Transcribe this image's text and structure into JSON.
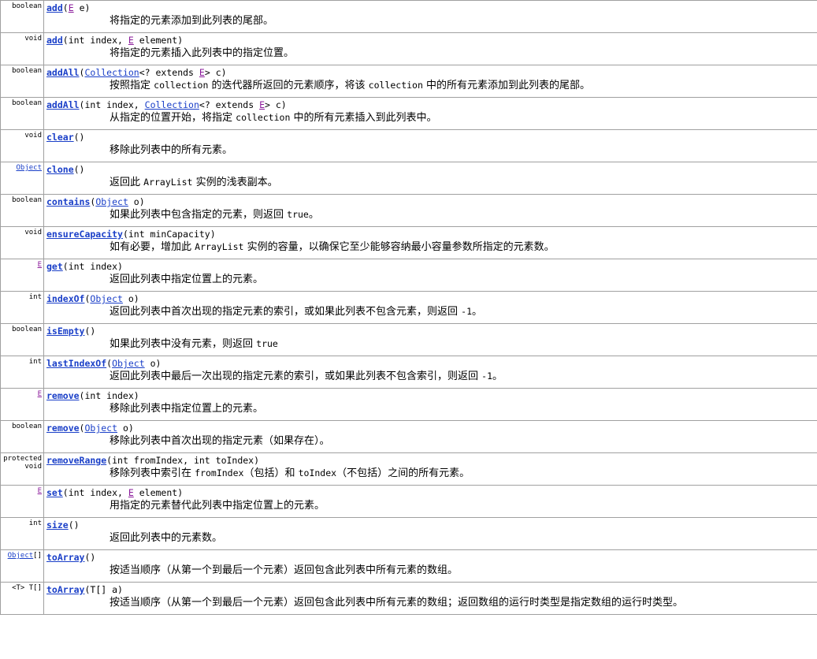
{
  "methods": [
    {
      "type": [
        {
          "text": "boolean",
          "link": false
        }
      ],
      "sig": [
        {
          "t": "name",
          "v": "add"
        },
        {
          "t": "plain",
          "v": "("
        },
        {
          "t": "generic",
          "v": "E"
        },
        {
          "t": "plain",
          "v": " e)"
        }
      ],
      "desc": [
        {
          "t": "text",
          "v": "将指定的元素添加到此列表的尾部。"
        }
      ]
    },
    {
      "type": [
        {
          "text": "void",
          "link": false
        }
      ],
      "sig": [
        {
          "t": "name",
          "v": "add"
        },
        {
          "t": "plain",
          "v": "(int index, "
        },
        {
          "t": "generic",
          "v": "E"
        },
        {
          "t": "plain",
          "v": " element)"
        }
      ],
      "desc": [
        {
          "t": "text",
          "v": "将指定的元素插入此列表中的指定位置。"
        }
      ]
    },
    {
      "type": [
        {
          "text": "boolean",
          "link": false
        }
      ],
      "sig": [
        {
          "t": "name",
          "v": "addAll"
        },
        {
          "t": "plain",
          "v": "("
        },
        {
          "t": "link",
          "v": "Collection"
        },
        {
          "t": "plain",
          "v": "<? extends "
        },
        {
          "t": "generic",
          "v": "E"
        },
        {
          "t": "plain",
          "v": "> c)"
        }
      ],
      "desc": [
        {
          "t": "text",
          "v": "按照指定 "
        },
        {
          "t": "code",
          "v": "collection"
        },
        {
          "t": "text",
          "v": " 的迭代器所返回的元素顺序，将该 "
        },
        {
          "t": "code",
          "v": "collection"
        },
        {
          "t": "text",
          "v": " 中的所有元素添加到此列表的尾部。"
        }
      ]
    },
    {
      "type": [
        {
          "text": "boolean",
          "link": false
        }
      ],
      "sig": [
        {
          "t": "name",
          "v": "addAll"
        },
        {
          "t": "plain",
          "v": "(int index, "
        },
        {
          "t": "link",
          "v": "Collection"
        },
        {
          "t": "plain",
          "v": "<? extends "
        },
        {
          "t": "generic",
          "v": "E"
        },
        {
          "t": "plain",
          "v": "> c)"
        }
      ],
      "desc": [
        {
          "t": "text",
          "v": "从指定的位置开始，将指定 "
        },
        {
          "t": "code",
          "v": "collection"
        },
        {
          "t": "text",
          "v": " 中的所有元素插入到此列表中。"
        }
      ]
    },
    {
      "type": [
        {
          "text": "void",
          "link": false
        }
      ],
      "sig": [
        {
          "t": "name",
          "v": "clear"
        },
        {
          "t": "plain",
          "v": "()"
        }
      ],
      "desc": [
        {
          "t": "text",
          "v": "移除此列表中的所有元素。"
        }
      ]
    },
    {
      "type": [
        {
          "text": "Object",
          "link": true
        }
      ],
      "sig": [
        {
          "t": "name",
          "v": "clone"
        },
        {
          "t": "plain",
          "v": "()"
        }
      ],
      "desc": [
        {
          "t": "text",
          "v": "返回此 "
        },
        {
          "t": "code",
          "v": "ArrayList"
        },
        {
          "t": "text",
          "v": " 实例的浅表副本。"
        }
      ]
    },
    {
      "type": [
        {
          "text": "boolean",
          "link": false
        }
      ],
      "sig": [
        {
          "t": "name",
          "v": "contains"
        },
        {
          "t": "plain",
          "v": "("
        },
        {
          "t": "link",
          "v": "Object"
        },
        {
          "t": "plain",
          "v": " o)"
        }
      ],
      "desc": [
        {
          "t": "text",
          "v": "如果此列表中包含指定的元素，则返回 "
        },
        {
          "t": "code",
          "v": "true"
        },
        {
          "t": "text",
          "v": "。"
        }
      ]
    },
    {
      "type": [
        {
          "text": "void",
          "link": false
        }
      ],
      "sig": [
        {
          "t": "name",
          "v": "ensureCapacity"
        },
        {
          "t": "plain",
          "v": "(int minCapacity)"
        }
      ],
      "desc": [
        {
          "t": "text",
          "v": "如有必要，增加此 "
        },
        {
          "t": "code",
          "v": "ArrayList"
        },
        {
          "t": "text",
          "v": " 实例的容量，以确保它至少能够容纳最小容量参数所指定的元素数。"
        }
      ]
    },
    {
      "type": [
        {
          "text": "E",
          "link": true,
          "generic": true
        }
      ],
      "sig": [
        {
          "t": "name",
          "v": "get"
        },
        {
          "t": "plain",
          "v": "(int index)"
        }
      ],
      "desc": [
        {
          "t": "text",
          "v": "返回此列表中指定位置上的元素。"
        }
      ]
    },
    {
      "type": [
        {
          "text": "int",
          "link": false
        }
      ],
      "sig": [
        {
          "t": "name",
          "v": "indexOf"
        },
        {
          "t": "plain",
          "v": "("
        },
        {
          "t": "link",
          "v": "Object"
        },
        {
          "t": "plain",
          "v": " o)"
        }
      ],
      "desc": [
        {
          "t": "text",
          "v": "返回此列表中首次出现的指定元素的索引，或如果此列表不包含元素，则返回 "
        },
        {
          "t": "code",
          "v": "-1"
        },
        {
          "t": "text",
          "v": "。"
        }
      ]
    },
    {
      "type": [
        {
          "text": "boolean",
          "link": false
        }
      ],
      "sig": [
        {
          "t": "name",
          "v": "isEmpty"
        },
        {
          "t": "plain",
          "v": "()"
        }
      ],
      "desc": [
        {
          "t": "text",
          "v": "如果此列表中没有元素，则返回 "
        },
        {
          "t": "code",
          "v": "true"
        }
      ]
    },
    {
      "type": [
        {
          "text": "int",
          "link": false
        }
      ],
      "sig": [
        {
          "t": "name",
          "v": "lastIndexOf"
        },
        {
          "t": "plain",
          "v": "("
        },
        {
          "t": "link",
          "v": "Object"
        },
        {
          "t": "plain",
          "v": " o)"
        }
      ],
      "desc": [
        {
          "t": "text",
          "v": "返回此列表中最后一次出现的指定元素的索引，或如果此列表不包含索引，则返回 "
        },
        {
          "t": "code",
          "v": "-1"
        },
        {
          "t": "text",
          "v": "。"
        }
      ]
    },
    {
      "type": [
        {
          "text": "E",
          "link": true,
          "generic": true
        }
      ],
      "sig": [
        {
          "t": "name",
          "v": "remove"
        },
        {
          "t": "plain",
          "v": "(int index)"
        }
      ],
      "desc": [
        {
          "t": "text",
          "v": "移除此列表中指定位置上的元素。"
        }
      ]
    },
    {
      "type": [
        {
          "text": "boolean",
          "link": false
        }
      ],
      "sig": [
        {
          "t": "name",
          "v": "remove"
        },
        {
          "t": "plain",
          "v": "("
        },
        {
          "t": "link",
          "v": "Object"
        },
        {
          "t": "plain",
          "v": " o)"
        }
      ],
      "desc": [
        {
          "t": "text",
          "v": "移除此列表中首次出现的指定元素（如果存在）。"
        }
      ]
    },
    {
      "type": [
        {
          "text": "protected",
          "link": false
        },
        {
          "text": "void",
          "link": false
        }
      ],
      "sig": [
        {
          "t": "name",
          "v": "removeRange"
        },
        {
          "t": "plain",
          "v": "(int fromIndex, int toIndex)"
        }
      ],
      "desc": [
        {
          "t": "text",
          "v": "移除列表中索引在 "
        },
        {
          "t": "code",
          "v": "fromIndex"
        },
        {
          "t": "text",
          "v": "（包括）和 "
        },
        {
          "t": "code",
          "v": "toIndex"
        },
        {
          "t": "text",
          "v": "（不包括）之间的所有元素。"
        }
      ]
    },
    {
      "type": [
        {
          "text": "E",
          "link": true,
          "generic": true
        }
      ],
      "sig": [
        {
          "t": "name",
          "v": "set"
        },
        {
          "t": "plain",
          "v": "(int index, "
        },
        {
          "t": "generic",
          "v": "E"
        },
        {
          "t": "plain",
          "v": " element)"
        }
      ],
      "desc": [
        {
          "t": "text",
          "v": "用指定的元素替代此列表中指定位置上的元素。"
        }
      ]
    },
    {
      "type": [
        {
          "text": "int",
          "link": false
        }
      ],
      "sig": [
        {
          "t": "name",
          "v": "size"
        },
        {
          "t": "plain",
          "v": "()"
        }
      ],
      "desc": [
        {
          "t": "text",
          "v": "返回此列表中的元素数。"
        }
      ]
    },
    {
      "type": [
        {
          "text": "Object",
          "link": true
        },
        {
          "text": "[]",
          "link": false,
          "inline": true
        }
      ],
      "sig": [
        {
          "t": "name",
          "v": "toArray"
        },
        {
          "t": "plain",
          "v": "()"
        }
      ],
      "desc": [
        {
          "t": "text",
          "v": "按适当顺序（从第一个到最后一个元素）返回包含此列表中所有元素的数组。"
        }
      ]
    },
    {
      "type": [
        {
          "text": "<T> T[]",
          "link": false
        }
      ],
      "sig": [
        {
          "t": "name",
          "v": "toArray"
        },
        {
          "t": "plain",
          "v": "(T[] a)"
        }
      ],
      "desc": [
        {
          "t": "text",
          "v": "按适当顺序（从第一个到最后一个元素）返回包含此列表中所有元素的数组；返回数组的运行时类型是指定数组的运行时类型。"
        }
      ]
    }
  ]
}
